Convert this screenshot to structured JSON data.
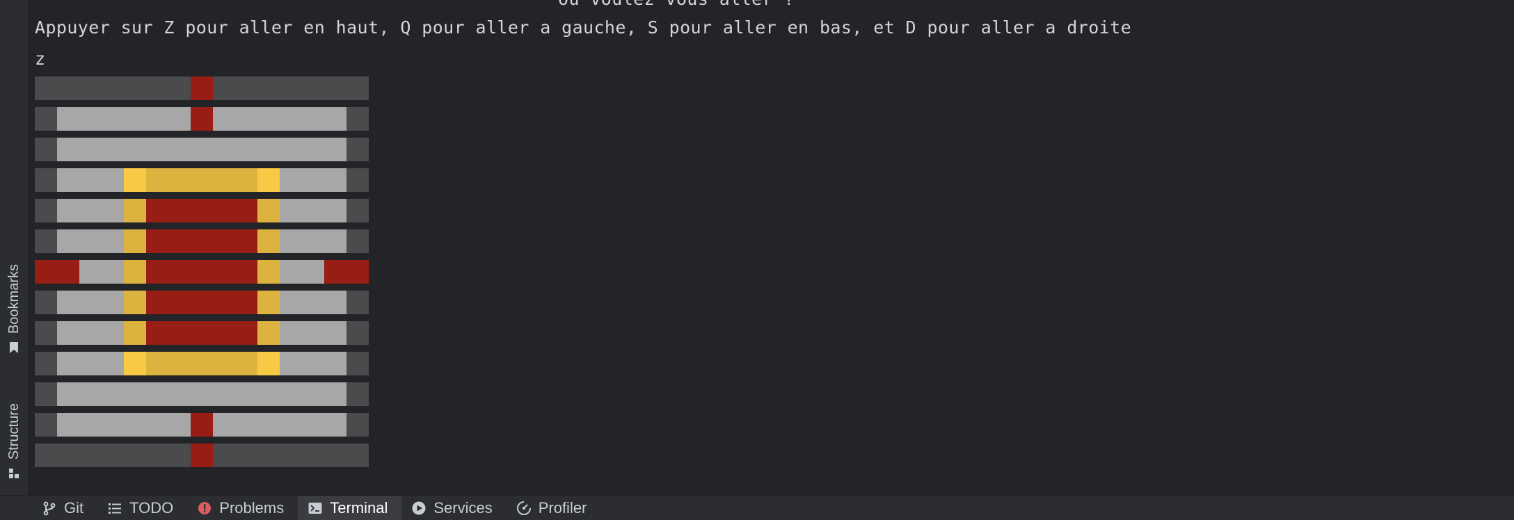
{
  "terminal": {
    "cut_line": "Où voulez vous aller ?",
    "instruction": "Appuyer sur Z pour aller en haut, Q pour aller a gauche, S pour aller en bas, et D pour aller a droite",
    "input": "z"
  },
  "colors": {
    "W": "#4a4b4d",
    "G": "#a7a7a7",
    "R": "#971d15",
    "Y": "#dcb33e",
    "L": "#f7c944"
  },
  "board": [
    "WWWWWWRWWWWWW",
    "WGGGGGRGGGGGW",
    "WGGGGGGGGGGGW",
    "WGGLYYYYYLGGW",
    "WGGYRRRRRYGGW",
    "WGGYRRRRRYGGW",
    "RRGYRRRRRYGRR",
    "WGGYRRRRRYGGW",
    "WGGYRRRRRYGGW",
    "WGGLYYYYYLGGW",
    "WGGGGGGGGGGGW",
    "WGGGGGRGGGGGW",
    "WWWWWWRWWWWWW"
  ],
  "sidebar": {
    "bookmarks": "Bookmarks",
    "structure": "Structure"
  },
  "bottom_tabs": [
    {
      "label": "Git",
      "icon": "git-branch-icon"
    },
    {
      "label": "TODO",
      "icon": "list-icon"
    },
    {
      "label": "Problems",
      "icon": "error-icon"
    },
    {
      "label": "Terminal",
      "icon": "terminal-icon",
      "active": true
    },
    {
      "label": "Services",
      "icon": "play-icon"
    },
    {
      "label": "Profiler",
      "icon": "profiler-icon"
    }
  ]
}
